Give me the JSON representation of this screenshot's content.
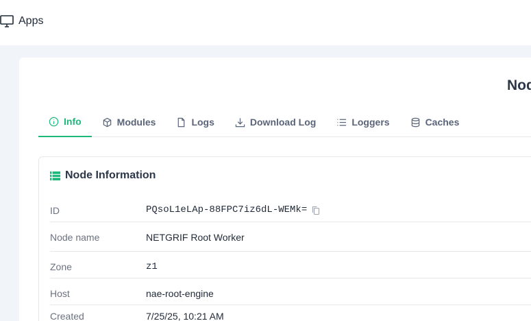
{
  "topbar": {
    "apps_label": "Apps"
  },
  "page": {
    "title": "Node"
  },
  "tabs": [
    {
      "label": "Info"
    },
    {
      "label": "Modules"
    },
    {
      "label": "Logs"
    },
    {
      "label": "Download Log"
    },
    {
      "label": "Loggers"
    },
    {
      "label": "Caches"
    }
  ],
  "node_info": {
    "heading": "Node Information",
    "rows": [
      {
        "label": "ID",
        "value": "PQsoL1eLAp-88FPC7iz6dL-WEMk="
      },
      {
        "label": "Node name",
        "value": "NETGRIF Root Worker"
      },
      {
        "label": "Zone",
        "value": "z1"
      },
      {
        "label": "Host",
        "value": "nae-root-engine"
      },
      {
        "label": "Created",
        "value": "7/25/25, 10:21 AM"
      }
    ]
  },
  "colors": {
    "accent": "#1db97a",
    "background": "#f1f4f8"
  }
}
